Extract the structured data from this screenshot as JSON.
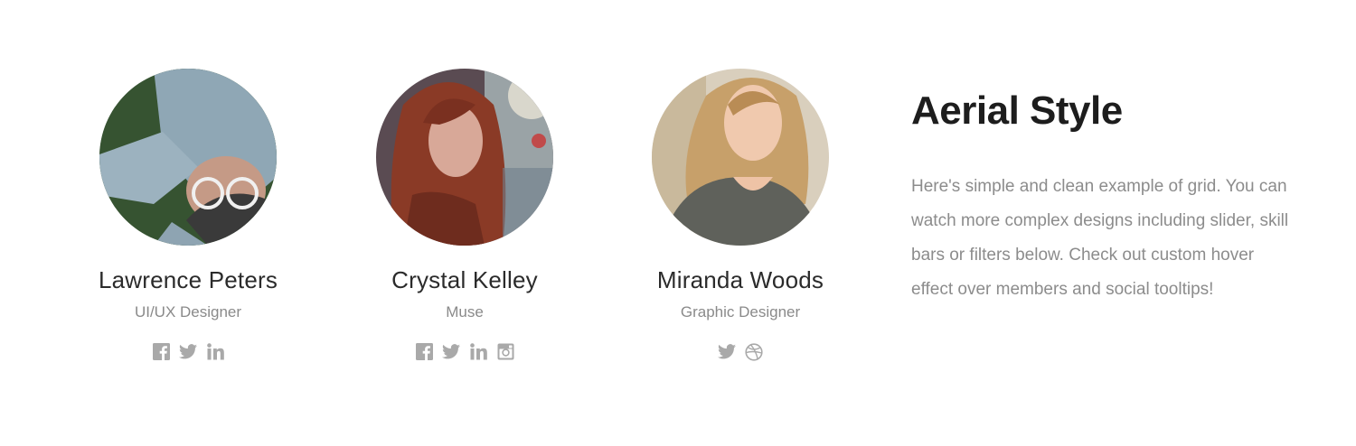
{
  "members": [
    {
      "name": "Lawrence Peters",
      "role": "UI/UX Designer",
      "socials": [
        "facebook-icon",
        "twitter-icon",
        "linkedin-icon"
      ]
    },
    {
      "name": "Crystal Kelley",
      "role": "Muse",
      "socials": [
        "facebook-icon",
        "twitter-icon",
        "linkedin-icon",
        "instagram-icon"
      ]
    },
    {
      "name": "Miranda Woods",
      "role": "Graphic Designer",
      "socials": [
        "twitter-icon",
        "dribbble-icon"
      ]
    }
  ],
  "intro": {
    "title": "Aerial Style",
    "body": "Here's simple and clean example of grid. You can watch more complex designs including slider, skill bars or filters below. Check out custom hover effect over members and social tooltips!"
  },
  "colors": {
    "icon": "#a9a9a9",
    "name": "#2b2b2b",
    "role": "#8a8a8a",
    "title": "#1d1d1d",
    "body": "#8c8c8c"
  }
}
